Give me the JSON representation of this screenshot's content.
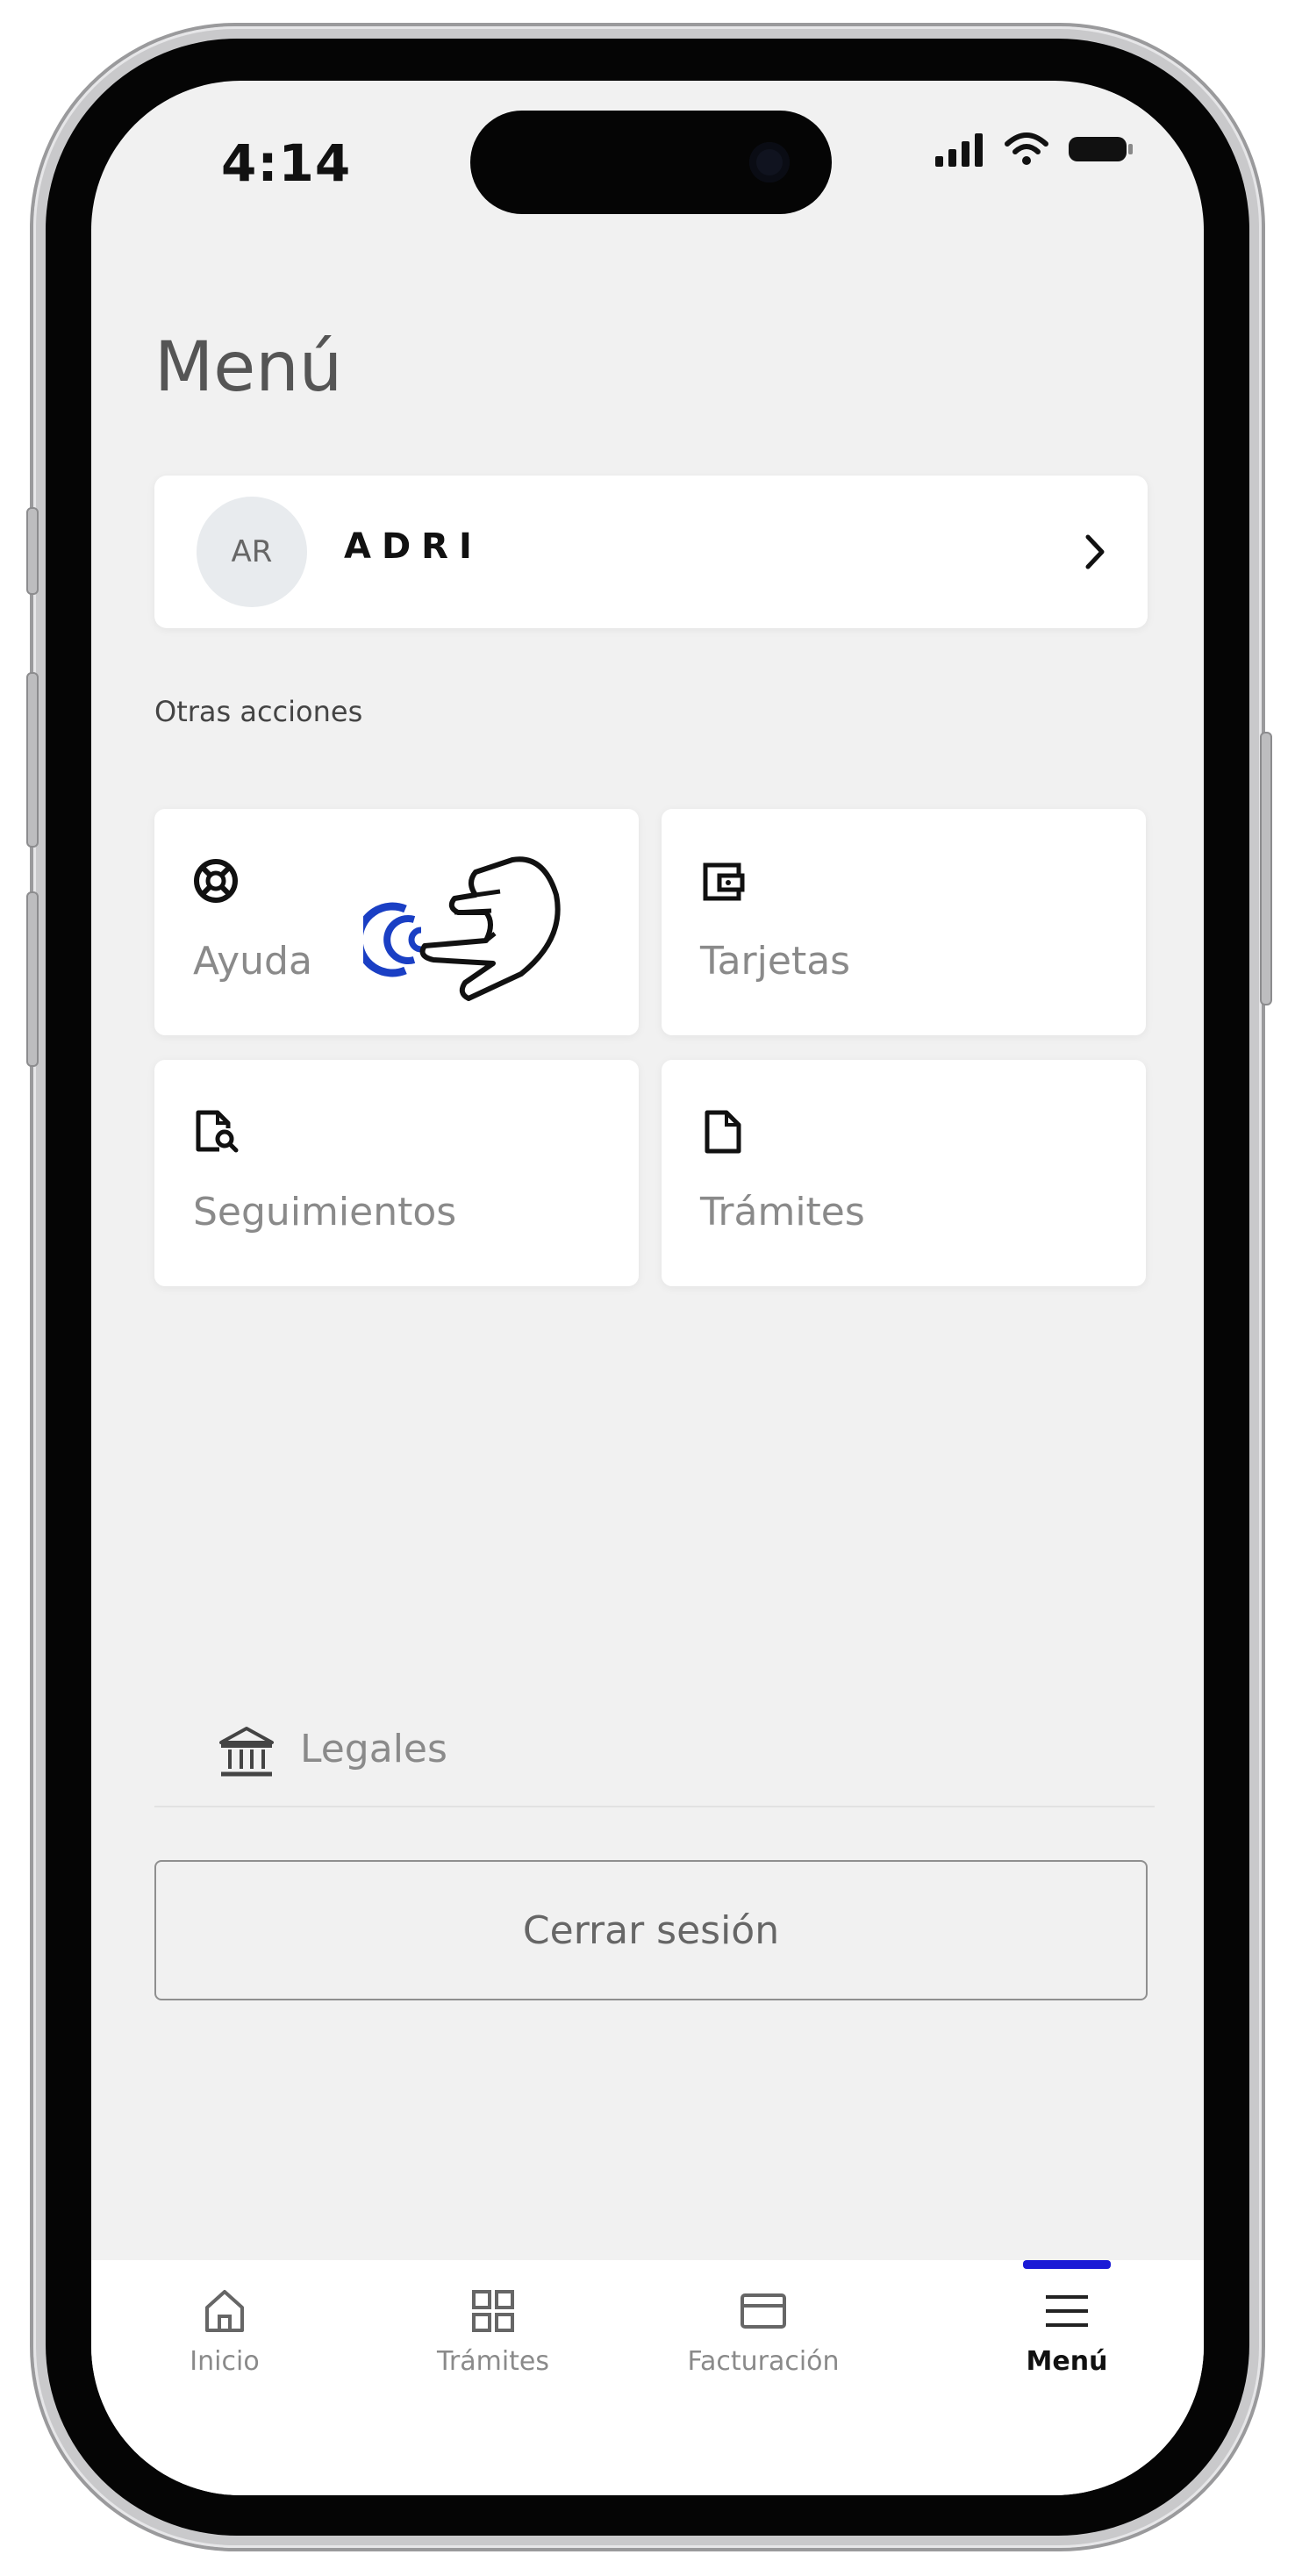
{
  "status_bar": {
    "time": "4:14"
  },
  "page": {
    "title": "Menú"
  },
  "profile": {
    "initials": "AR",
    "name": "ADRI"
  },
  "other_actions": {
    "label": "Otras acciones",
    "tiles": [
      {
        "label": "Ayuda",
        "icon": "lifebuoy-icon"
      },
      {
        "label": "Tarjetas",
        "icon": "wallet-icon"
      },
      {
        "label": "Seguimientos",
        "icon": "document-search-icon"
      },
      {
        "label": "Trámites",
        "icon": "document-icon"
      }
    ]
  },
  "legales": {
    "label": "Legales",
    "icon": "bank-icon"
  },
  "logout": {
    "label": "Cerrar sesión"
  },
  "tabbar": {
    "items": [
      {
        "label": "Inicio",
        "icon": "home-icon"
      },
      {
        "label": "Trámites",
        "icon": "grid-icon"
      },
      {
        "label": "Facturación",
        "icon": "card-icon"
      },
      {
        "label": "Menú",
        "icon": "hamburger-icon"
      }
    ],
    "active_index": 3,
    "accent_color": "#1a1ad6"
  }
}
